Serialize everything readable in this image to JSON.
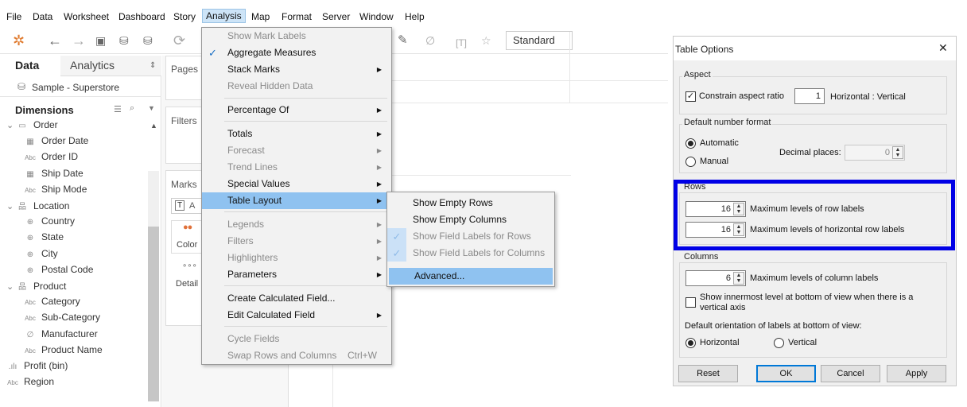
{
  "menubar": [
    "File",
    "Data",
    "Worksheet",
    "Dashboard",
    "Story",
    "Analysis",
    "Map",
    "Format",
    "Server",
    "Window",
    "Help"
  ],
  "toolbar": {
    "standard": "Standard"
  },
  "sidebar": {
    "tab_data": "Data",
    "tab_analytics": "Analytics",
    "datasource": "Sample - Superstore",
    "dimensions_label": "Dimensions",
    "items": [
      {
        "label": "Order",
        "icon": "folder-icon"
      },
      {
        "label": "Order Date",
        "icon": "calendar-icon"
      },
      {
        "label": "Order ID",
        "icon": "abc-icon"
      },
      {
        "label": "Ship Date",
        "icon": "calendar-icon"
      },
      {
        "label": "Ship Mode",
        "icon": "abc-icon"
      },
      {
        "label": "Location",
        "icon": "hierarchy-icon"
      },
      {
        "label": "Country",
        "icon": "globe-icon"
      },
      {
        "label": "State",
        "icon": "globe-icon"
      },
      {
        "label": "City",
        "icon": "globe-icon"
      },
      {
        "label": "Postal Code",
        "icon": "globe-icon"
      },
      {
        "label": "Product",
        "icon": "hierarchy-icon"
      },
      {
        "label": "Category",
        "icon": "abc-icon"
      },
      {
        "label": "Sub-Category",
        "icon": "abc-icon"
      },
      {
        "label": "Manufacturer",
        "icon": "paperclip-icon"
      },
      {
        "label": "Product Name",
        "icon": "abc-icon"
      },
      {
        "label": "Profit (bin)",
        "icon": "histogram-icon"
      },
      {
        "label": "Region",
        "icon": "abc-icon"
      }
    ]
  },
  "cards": {
    "pages": "Pages",
    "filters": "Filters",
    "marks": "Marks",
    "color": "Color",
    "detail": "Detail",
    "marks_type": "A"
  },
  "analysis_menu": {
    "items": [
      {
        "label": "Show Mark Labels"
      },
      {
        "label": "Aggregate Measures"
      },
      {
        "label": "Stack Marks"
      },
      {
        "label": "Reveal Hidden Data"
      },
      {
        "label": "Percentage Of"
      },
      {
        "label": "Totals"
      },
      {
        "label": "Forecast"
      },
      {
        "label": "Trend Lines"
      },
      {
        "label": "Special Values"
      },
      {
        "label": "Table Layout"
      },
      {
        "label": "Legends"
      },
      {
        "label": "Filters"
      },
      {
        "label": "Highlighters"
      },
      {
        "label": "Parameters"
      },
      {
        "label": "Create Calculated Field..."
      },
      {
        "label": "Edit Calculated Field"
      },
      {
        "label": "Cycle Fields"
      },
      {
        "label": "Swap Rows and Columns",
        "shortcut": "Ctrl+W"
      }
    ]
  },
  "table_layout_submenu": {
    "items": [
      {
        "label": "Show Empty Rows"
      },
      {
        "label": "Show Empty Columns"
      },
      {
        "label": "Show Field Labels for Rows"
      },
      {
        "label": "Show Field Labels for Columns"
      },
      {
        "label": "Advanced..."
      }
    ]
  },
  "dialog": {
    "title": "Table Options",
    "aspect": {
      "label": "Aspect",
      "constrain_label": "Constrain aspect ratio",
      "constrain_checked": true,
      "ratio_value": "1",
      "ratio_suffix": "Horizontal : Vertical"
    },
    "number_format": {
      "label": "Default number format",
      "automatic": "Automatic",
      "manual": "Manual",
      "selected": "Automatic",
      "decimal_label": "Decimal places:",
      "decimal_value": "0"
    },
    "rows": {
      "label": "Rows",
      "max_row_labels_value": "16",
      "max_row_labels_label": "Maximum levels of row labels",
      "max_horiz_row_labels_value": "16",
      "max_horiz_row_labels_label": "Maximum levels of horizontal row labels"
    },
    "columns": {
      "label": "Columns",
      "max_col_labels_value": "6",
      "max_col_labels_label": "Maximum levels of column labels",
      "innermost_label_line1": "Show innermost level at bottom of view when there is a",
      "innermost_label_line2": "vertical axis",
      "innermost_checked": false,
      "orientation_label": "Default orientation of labels at bottom of view:",
      "horizontal": "Horizontal",
      "vertical": "Vertical",
      "orientation_selected": "Horizontal"
    },
    "buttons": {
      "reset": "Reset",
      "ok": "OK",
      "cancel": "Cancel",
      "apply": "Apply"
    },
    "close_glyph": "✕"
  },
  "colors": {
    "highlight_border": "#0000e6",
    "menu_highlight": "#8fc2f0",
    "check": "#1a6fc4"
  }
}
